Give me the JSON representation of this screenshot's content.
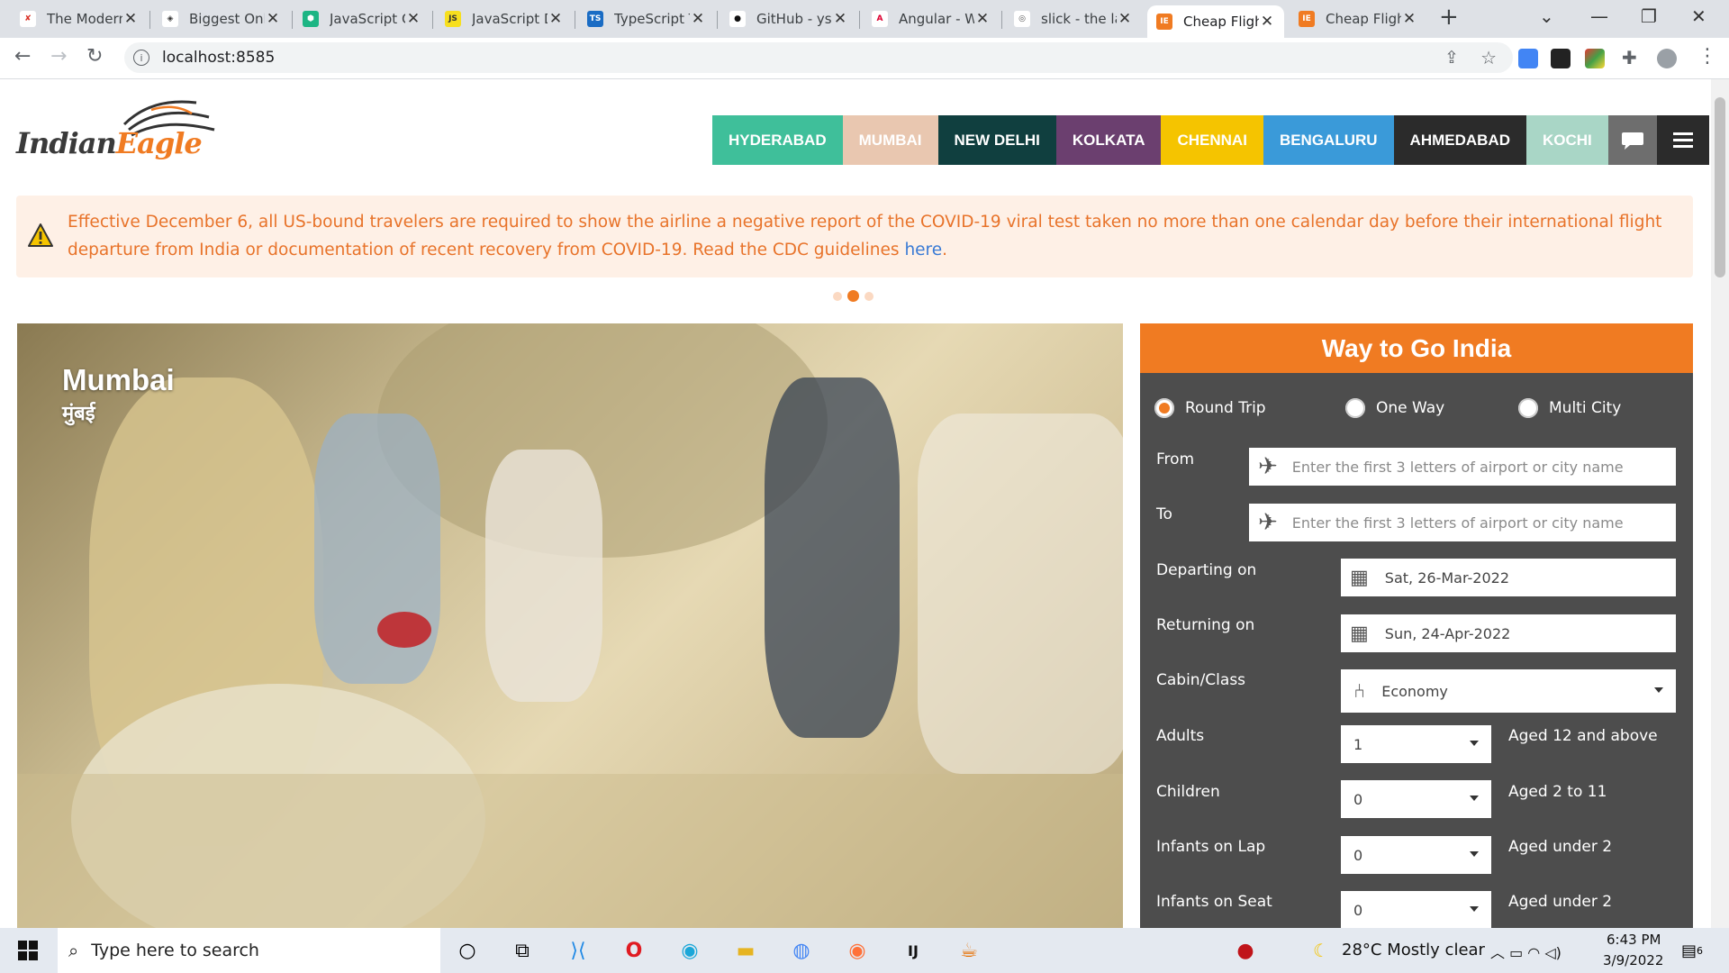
{
  "browser": {
    "tabs": [
      {
        "title": "The Modern",
        "fav_color": "#ffffff",
        "fav_glyph": "✘",
        "fav_text": "#d93025"
      },
      {
        "title": "Biggest Onl",
        "fav_color": "#ffffff",
        "fav_glyph": "◈",
        "fav_text": "#333"
      },
      {
        "title": "JavaScript C",
        "fav_color": "#1db584",
        "fav_glyph": "⬢",
        "fav_text": "#fff"
      },
      {
        "title": "JavaScript D",
        "fav_color": "#f7df1e",
        "fav_glyph": "JS",
        "fav_text": "#333"
      },
      {
        "title": "TypeScript T",
        "fav_color": "#1a6cc4",
        "fav_glyph": "TS",
        "fav_text": "#fff"
      },
      {
        "title": "GitHub - ys",
        "fav_color": "#ffffff",
        "fav_glyph": "●",
        "fav_text": "#111"
      },
      {
        "title": "Angular - W",
        "fav_color": "#ffffff",
        "fav_glyph": "A",
        "fav_text": "#dd0031"
      },
      {
        "title": "slick - the la",
        "fav_color": "#ffffff",
        "fav_glyph": "◎",
        "fav_text": "#555"
      },
      {
        "title": "Cheap Fligh",
        "fav_color": "#f07b22",
        "fav_glyph": "IE",
        "fav_text": "#fff"
      },
      {
        "title": "Cheap Fligh",
        "fav_color": "#f07b22",
        "fav_glyph": "IE",
        "fav_text": "#fff"
      }
    ],
    "active_tab": 8,
    "url": "localhost:8585"
  },
  "site": {
    "logo_part1": "Indian",
    "logo_part2": "Eagle",
    "cities": [
      {
        "label": "HYDERABAD",
        "color": "#3fbf9a"
      },
      {
        "label": "MUMBAI",
        "color": "#e9c7b0"
      },
      {
        "label": "NEW DELHI",
        "color": "#103f3f"
      },
      {
        "label": "KOLKATA",
        "color": "#6b3f6f"
      },
      {
        "label": "CHENNAI",
        "color": "#f5c400"
      },
      {
        "label": "BENGALURU",
        "color": "#3a9ad9"
      },
      {
        "label": "AHMEDABAD",
        "color": "#2b2b2b"
      },
      {
        "label": "KOCHI",
        "color": "#a9d6c6"
      }
    ],
    "chat_icon_color": "#6e6e6e",
    "menu_icon_color": "#2b2b2b"
  },
  "alert": {
    "text": "Effective December 6, all US-bound travelers are required to show the airline a negative report of the COVID-19 viral test taken no more than one calendar day before their international flight departure from India or documentation of recent recovery from COVID-19. Read the CDC guidelines ",
    "link": "here",
    "end": "."
  },
  "hero": {
    "city": "Mumbai",
    "city_native": "मुंबई"
  },
  "booking": {
    "title": "Way to Go India",
    "trip_types": [
      "Round Trip",
      "One Way",
      "Multi City"
    ],
    "selected_trip": 0,
    "from_label": "From",
    "from_placeholder": "Enter the first 3 letters of airport or city name",
    "to_label": "To",
    "to_placeholder": "Enter the first 3 letters of airport or city name",
    "depart_label": "Departing on",
    "depart_value": "Sat, 26-Mar-2022",
    "return_label": "Returning on",
    "return_value": "Sun, 24-Apr-2022",
    "cabin_label": "Cabin/Class",
    "cabin_value": "Economy",
    "adults_label": "Adults",
    "adults_value": "1",
    "adults_note": "Aged 12 and above",
    "children_label": "Children",
    "children_value": "0",
    "children_note": "Aged 2 to 11",
    "infants_lap_label": "Infants on Lap",
    "infants_lap_value": "0",
    "infants_lap_note": "Aged under 2",
    "infants_seat_label": "Infants on Seat",
    "infants_seat_value": "0",
    "infants_seat_note": "Aged under 2"
  },
  "taskbar": {
    "search_placeholder": "Type here to search",
    "weather": "28°C  Mostly clear",
    "time": "6:43 PM",
    "date": "3/9/2022",
    "notifications": "6"
  }
}
